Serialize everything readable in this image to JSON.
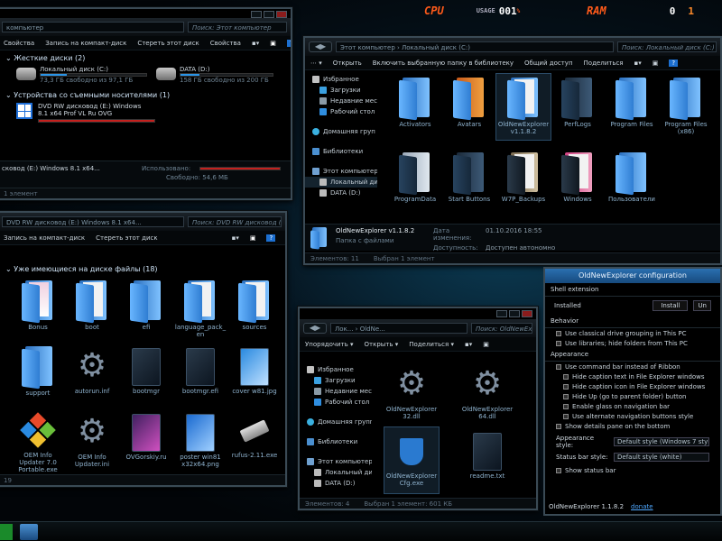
{
  "perf": {
    "cpu_label": "CPU",
    "usage_label": "USAGE",
    "cpu_value": "001",
    "cpu_unit": "%",
    "ram_label": "RAM",
    "ram_value": "0",
    "ram_extra": "1"
  },
  "w1": {
    "address": "компьютер",
    "search": "Поиск: Этот компьютер",
    "cmds": [
      "Свойства",
      "Запись на компакт-диск",
      "Стереть этот диск",
      "Свойства"
    ],
    "group1": "Жесткие диски (2)",
    "drives": [
      {
        "name": "Локальный диск (C:)",
        "free": "73,3 ГБ свободно из 97,1 ГБ",
        "fill": 0.25
      },
      {
        "name": "DATA (D:)",
        "free": "158 ГБ свободно из 200 ГБ",
        "fill": 0.21
      }
    ],
    "group2": "Устройства со съемными носителями (1)",
    "dvd_title": "DVD RW дисковод (E:) Windows",
    "dvd_sub": "8.1 x64 Prof VL Ru OVG",
    "detail_name": "сковод (E:) Windows 8.1 x64...",
    "used_label": "Использовано:",
    "free_label": "Свободно:",
    "free_value": "54,6 МБ",
    "status": "1 элемент"
  },
  "w2": {
    "address": "Этот компьютер  ›  Локальный диск (C:)",
    "search": "Поиск: Локальный диск (C:)",
    "cmds": [
      "Открыть",
      "Включить выбранную папку в библиотеку",
      "Общий доступ",
      "Поделиться"
    ],
    "nav": [
      "Избранное",
      "Загрузки",
      "Недавние мест",
      "Рабочий стол",
      "Домашняя груп",
      "Библиотеки",
      "Этот компьютер",
      "Локальный диск",
      "DATA (D:)"
    ],
    "items": [
      "Activators",
      "Avatars",
      "OldNewExplorer v1.1.8.2",
      "PerfLogs",
      "Program Files",
      "Program Files (x86)",
      "ProgramData",
      "Start Buttons",
      "W7P_Backups",
      "Windows",
      "Пользователи"
    ],
    "detail_name": "OldNewExplorer v1.1.8.2",
    "detail_date_label": "Дата изменения:",
    "detail_date": "01.10.2016 18:55",
    "detail_type": "Папка с файлами",
    "detail_access_label": "Доступность:",
    "detail_access": "Доступен автономно",
    "status_items": "Элементов: 11",
    "status_sel": "Выбран 1 элемент"
  },
  "w3": {
    "address": "DVD RW дисковод (E:) Windows 8.1 x64...",
    "search": "Поиск: DVD RW дисковод (E:) Windo...",
    "cmds": [
      "Запись на компакт-диск",
      "Стереть этот диск"
    ],
    "group": "Уже имеющиеся на диске файлы (18)",
    "items": [
      "Bonus",
      "boot",
      "efi",
      "language_pack_en",
      "sources",
      "support",
      "autorun.inf",
      "bootmgr",
      "bootmgr.efi",
      "cover w81.jpg",
      "OEM Info Updater 7.0 Portable.exe",
      "OEM Info Updater.ini",
      "OVGorskiy.ru",
      "poster win81 x32x64.png",
      "rufus-2.11.exe"
    ],
    "status": "19"
  },
  "w4": {
    "address": "Лок... › OldNe...",
    "search": "Поиск: OldNewExpl...",
    "cmds": [
      "Упорядочить ▾",
      "Открыть ▾",
      "Поделиться ▾"
    ],
    "nav": [
      "Избранное",
      "Загрузки",
      "Недавние места",
      "Рабочий стол",
      "Домашняя групп",
      "Библиотеки",
      "Этот компьютер",
      "Локальный дис",
      "DATA (D:)"
    ],
    "items": [
      "OldNewExplorer32.dll",
      "OldNewExplorer64.dll",
      "OldNewExplorerCfg.exe",
      "readme.txt"
    ],
    "status_items": "Элементов: 4",
    "status_sel": "Выбран 1 элемент: 601 КБ"
  },
  "cfg": {
    "title": "OldNewExplorer configuration",
    "shell_ext": "Shell extension",
    "installed": "Installed",
    "install_btn": "Install",
    "uninstall_btn": "Un",
    "behavior": "Behavior",
    "behav_opts": [
      "Use classical drive grouping in This PC",
      "Use libraries; hide folders from This PC"
    ],
    "appearance": "Appearance",
    "app_opts": [
      "Use command bar instead of Ribbon",
      "Hide caption text in File Explorer windows",
      "Hide caption icon in File Explorer windows",
      "Hide Up (go to parent folder) button",
      "Enable glass on navigation bar",
      "Use alternate navigation buttons style",
      "Show details pane on the bottom"
    ],
    "app_style_label": "Appearance style:",
    "app_style_value": "Default style (Windows 7 style / skin style)",
    "status_style_label": "Status bar style:",
    "status_style_value": "Default style (white)",
    "show_status": "Show status bar",
    "version": "OldNewExplorer 1.1.8.2",
    "donate": "donate"
  }
}
